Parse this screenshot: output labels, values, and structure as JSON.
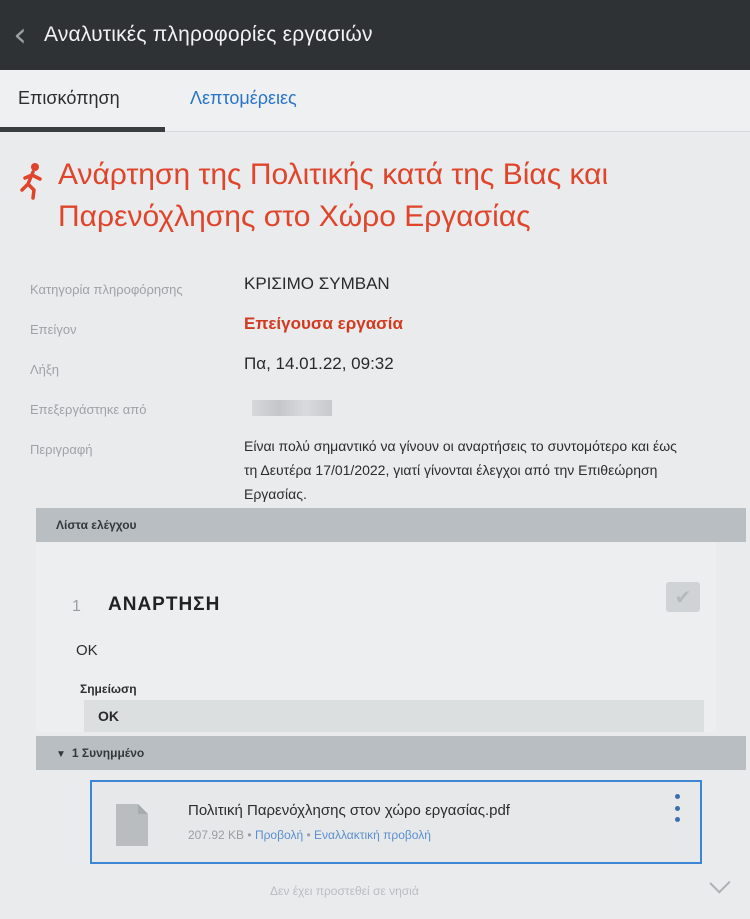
{
  "header": {
    "title": "Αναλυτικές πληροφορίες εργασιών"
  },
  "tabs": [
    {
      "label": "Επισκόπηση",
      "active": true
    },
    {
      "label": "Λεπτομέρειες",
      "active": false
    }
  ],
  "task": {
    "title": "Ανάρτηση της Πολιτικής κατά της Βίας και Παρενόχλησης στο Χώρο Εργασίας",
    "properties": {
      "category_label": "Κατηγορία πληροφόρησης",
      "category_value": "ΚΡΙΣΙΜΟ ΣΥΜΒΑΝ",
      "urgent_label": "Επείγον",
      "urgent_value": "Επείγουσα εργασία",
      "due_label": "Λήξη",
      "due_value": "Πα, 14.01.22, 09:32",
      "processed_label": "Επεξεργάστηκε από",
      "description_label": "Περιγραφή",
      "description_value": "Είναι πολύ σημαντικό να γίνουν οι αναρτήσεις το συντομότερο και έως τη Δευτέρα 17/01/2022, γιατί γίνονται έλεγχοι από την Επιθεώρηση Εργασίας."
    }
  },
  "checklist": {
    "section_label": "Λίστα ελέγχου",
    "items": [
      {
        "number": "1",
        "title": "ΑΝΑΡΤΗΣΗ",
        "answer": "OK",
        "note_label": "Σημείωση",
        "note_value": "OK"
      }
    ]
  },
  "attachments": {
    "section_label": "1 Συνημμένο",
    "files": [
      {
        "name": "Πολιτική Παρενόχλησης στον χώρο εργασίας.pdf",
        "size": "207.92 KB",
        "separator": "•",
        "view_label": "Προβολή",
        "alt_view_label": "Εναλλακτική προβολή"
      }
    ]
  },
  "footer": {
    "faint_text": "Δεν έχει προστεθεί σε νησιά"
  },
  "colors": {
    "title_red": "#e0452b",
    "urgent_red": "#d23a20",
    "tab_link_blue": "#2a74c9",
    "header_bg": "#2f3235",
    "file_border": "#3d86d6"
  },
  "icons": {
    "back": "chevron-left-icon",
    "task": "running-person-icon",
    "check": "checkmark-icon",
    "file": "document-icon",
    "more": "kebab-menu-icon"
  }
}
